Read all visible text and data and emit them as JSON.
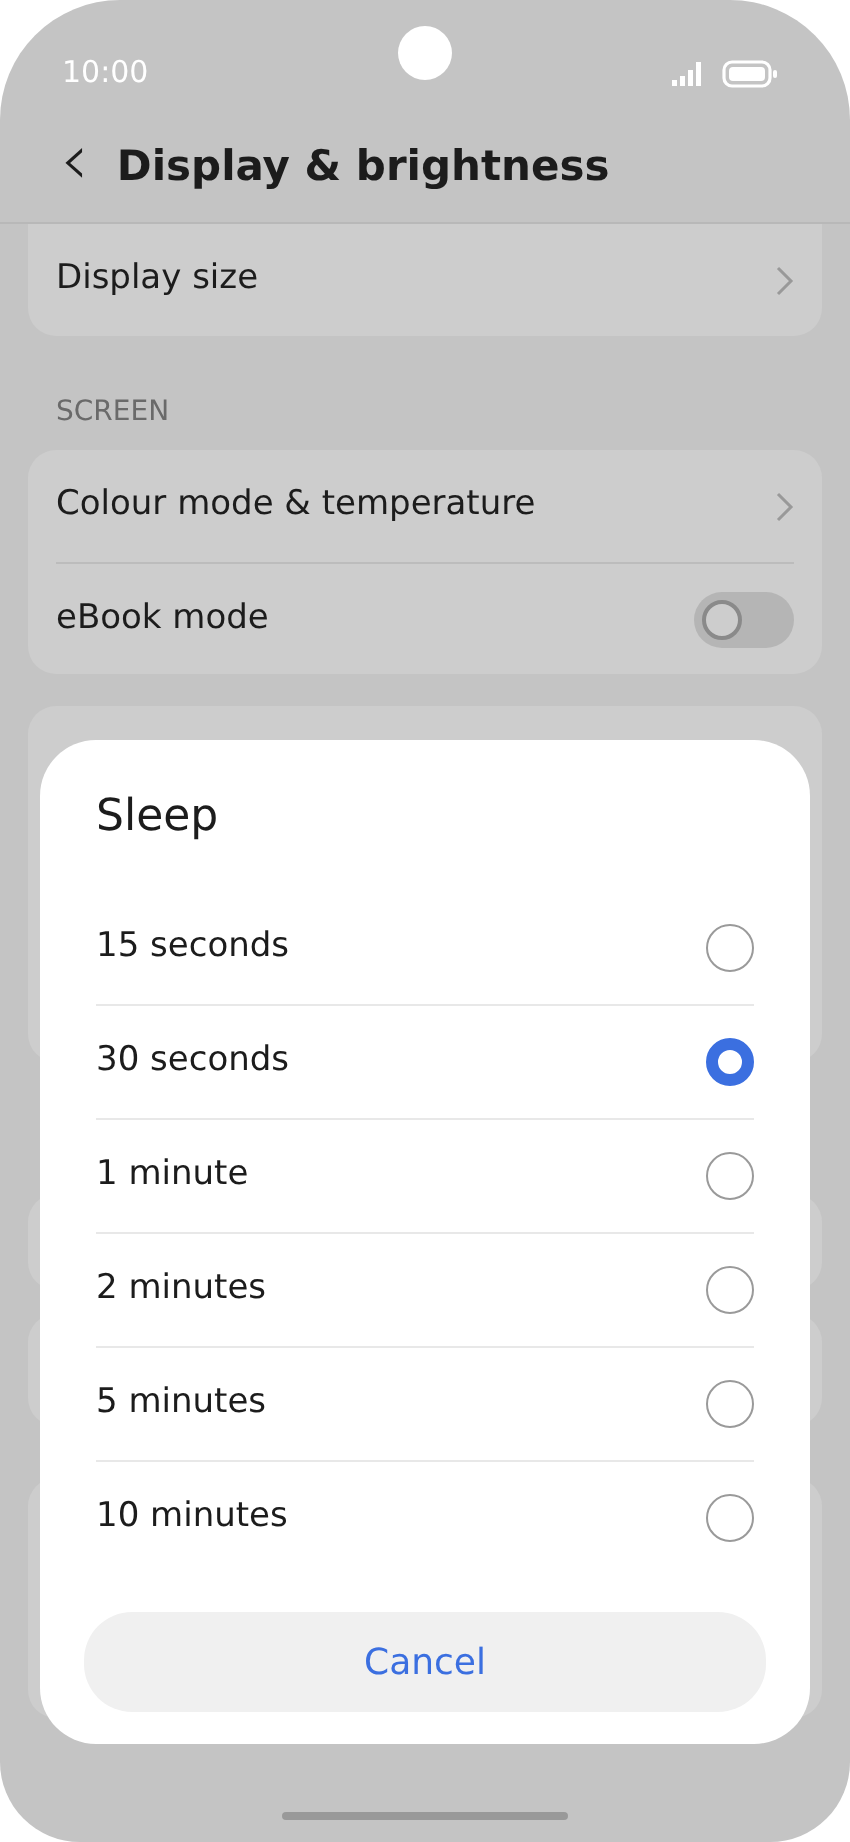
{
  "status_bar": {
    "time": "10:00"
  },
  "header": {
    "back": "‹",
    "title": "Display & brightness"
  },
  "settings": [
    {
      "kind": "card",
      "rows": [
        {
          "kind": "link",
          "label": "Display size"
        }
      ]
    },
    {
      "kind": "section",
      "label": "SCREEN"
    },
    {
      "kind": "card",
      "rows": [
        {
          "kind": "link",
          "label": "Colour mode & temperature"
        },
        {
          "kind": "toggle",
          "label": "eBook mode",
          "on": false
        }
      ]
    }
  ],
  "dialog": {
    "title": "Sleep",
    "options": [
      {
        "label": "15 seconds",
        "selected": false
      },
      {
        "label": "30 seconds",
        "selected": true
      },
      {
        "label": "1 minute",
        "selected": false
      },
      {
        "label": "2 minutes",
        "selected": false
      },
      {
        "label": "5 minutes",
        "selected": false
      },
      {
        "label": "10 minutes",
        "selected": false
      }
    ],
    "cancel": "Cancel"
  }
}
